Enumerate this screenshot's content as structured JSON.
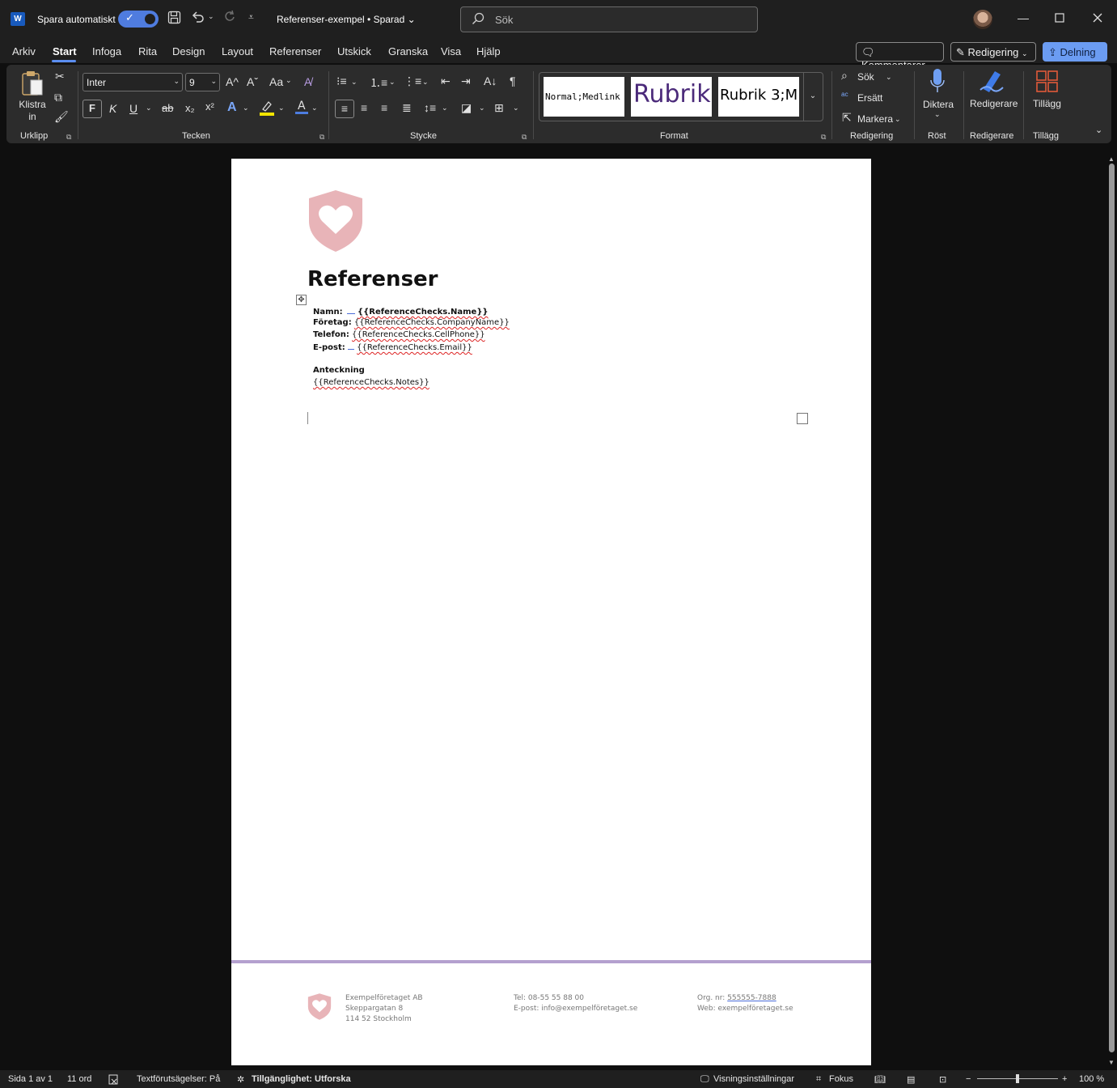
{
  "titlebar": {
    "app_logo": "W",
    "autosave_label": "Spara automatiskt",
    "autosave_on": true,
    "doc_title": "Referenser-exempel • Sparad ⌄",
    "search_placeholder": "Sök",
    "icons": [
      "save-icon",
      "undo-icon",
      "redo-icon",
      "customize-qat-icon",
      "search-icon",
      "minimize-icon",
      "maximize-icon",
      "close-icon"
    ]
  },
  "menu": {
    "tabs": [
      "Arkiv",
      "Start",
      "Infoga",
      "Rita",
      "Design",
      "Layout",
      "Referenser",
      "Utskick",
      "Granska",
      "Visa",
      "Hjälp"
    ],
    "active_tab": "Start",
    "comments_label": "Kommentarer",
    "editing_label": "Redigering",
    "share_label": "Delning"
  },
  "ribbon": {
    "clipboard": {
      "paste_label": "Klistra in",
      "group_label": "Urklipp"
    },
    "font": {
      "font_name": "Inter",
      "font_size": "9",
      "bold": "F",
      "italic": "K",
      "underline": "U",
      "strike": "ab",
      "subscript": "x₂",
      "superscript": "x²",
      "grow": "A^",
      "shrink": "Aˇ",
      "case": "Aa",
      "group_label": "Tecken"
    },
    "paragraph": {
      "pilcrow": "¶",
      "group_label": "Stycke"
    },
    "styles": {
      "items": [
        "Normal;Medlink t",
        "Rubrik",
        "Rubrik 3;M"
      ],
      "group_label": "Format"
    },
    "editing": {
      "find_label": "Sök",
      "replace_label": "Ersätt",
      "select_label": "Markera",
      "group_label": "Redigering"
    },
    "voice": {
      "dictate_label": "Diktera",
      "group_label": "Röst"
    },
    "editor": {
      "label": "Redigerare",
      "group_label": "Redigerare"
    },
    "addins": {
      "label": "Tillägg",
      "group_label": "Tillägg"
    },
    "accent_color": "#5b8ef0"
  },
  "document": {
    "heading": "Referenser",
    "fields": [
      {
        "label": "Namn:",
        "value": "{{ReferenceChecks.Name}}",
        "bold_value": true
      },
      {
        "label": "Företag:",
        "value": "{{ReferenceChecks.CompanyName}}",
        "bold_value": false
      },
      {
        "label": "Telefon:",
        "value": "{{ReferenceChecks.CellPhone}}",
        "bold_value": false
      },
      {
        "label": "E-post:",
        "value": "{{ReferenceChecks.Email}}",
        "bold_value": false
      }
    ],
    "notes_label": "Anteckning",
    "notes_value": "{{ReferenceChecks.Notes}}",
    "logo_color": "#e8b4b8",
    "footer_line_color": "#b4a0cf",
    "footer": {
      "company": "Exempelföretaget AB",
      "street": "Skeppargatan 8",
      "city": "114 52 Stockholm",
      "phone": "Tel: 08-55 55 88 00",
      "email": "E-post: info@exempelföretaget.se",
      "org_prefix": "Org. nr: ",
      "org_number": "555555-7888",
      "web": "Web: exempelföretaget.se"
    }
  },
  "statusbar": {
    "page": "Sida 1 av 1",
    "words": "11 ord",
    "predictions": "Textförutsägelser: På",
    "accessibility": "Tillgänglighet: Utforska",
    "display_settings": "Visningsinställningar",
    "focus": "Fokus",
    "zoom_minus": "−",
    "zoom_plus": "+",
    "zoom": "100 %",
    "zoom_fraction": 0.5
  }
}
